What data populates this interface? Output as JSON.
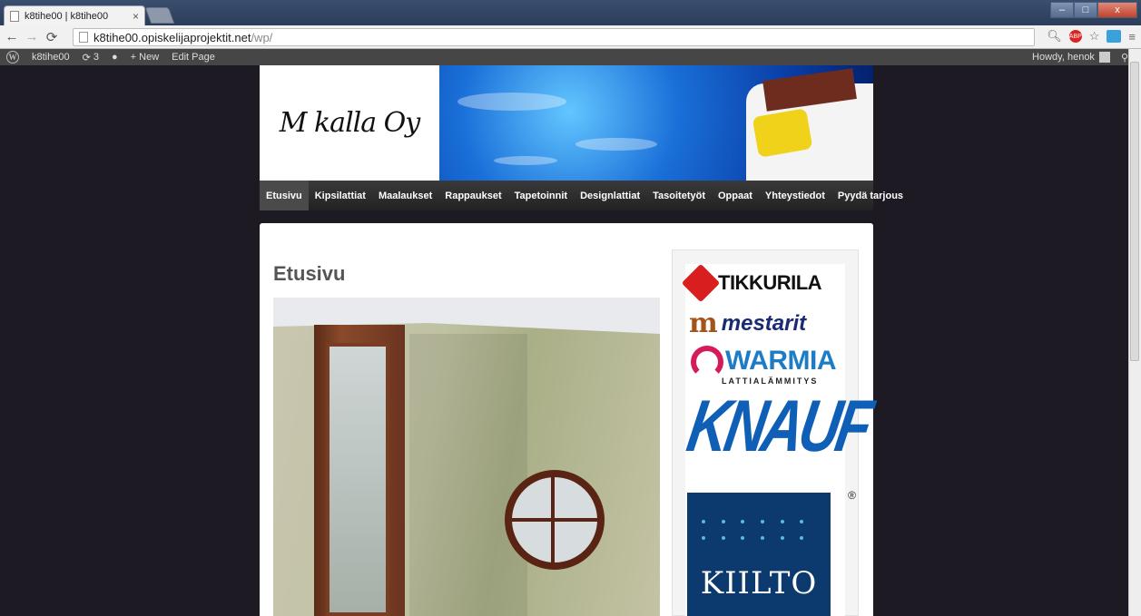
{
  "browser": {
    "tab_title": "k8tihe00 | k8tihe00",
    "tab_close": "×",
    "url_host": "k8tihe00.opiskelijaprojektit.net",
    "url_path": "/wp/",
    "ext_badge": "ABP",
    "win_minimize": "–",
    "win_maximize": "□",
    "win_close": "x"
  },
  "adminbar": {
    "wp_logo": "W",
    "site_name": "k8tihe00",
    "updates_count": "3",
    "new_label": "New",
    "edit_page_label": "Edit Page",
    "greeting": "Howdy, henok"
  },
  "site": {
    "logo_text": "M kalla Oy",
    "nav": [
      {
        "label": "Etusivu",
        "active": true
      },
      {
        "label": "Kipsilattiat"
      },
      {
        "label": "Maalaukset"
      },
      {
        "label": "Rappaukset"
      },
      {
        "label": "Tapetoinnit"
      },
      {
        "label": "Designlattiat"
      },
      {
        "label": "Tasoitetyöt"
      },
      {
        "label": "Oppaat"
      },
      {
        "label": "Yhteystiedot"
      },
      {
        "label": "Pyydä tarjous"
      }
    ],
    "page_title": "Etusivu"
  },
  "brands": {
    "tikkurila": "TIKKURILA",
    "mestarit_mark": "m",
    "mestarit": "mestarit",
    "warmia": "WARMIA",
    "warmia_sub": "LATTIALÄMMITYS",
    "knauf": "KNAUF",
    "knauf_reg": "®",
    "kiilto": "KIILTO"
  },
  "colors": {
    "page_bg": "#1e1a24",
    "nav_bg": "#222222",
    "tikkurila_red": "#d81e1e",
    "warmia_blue": "#1c7cc6",
    "knauf_blue": "#0f5fb6",
    "kiilto_navy": "#0c3a6e"
  }
}
